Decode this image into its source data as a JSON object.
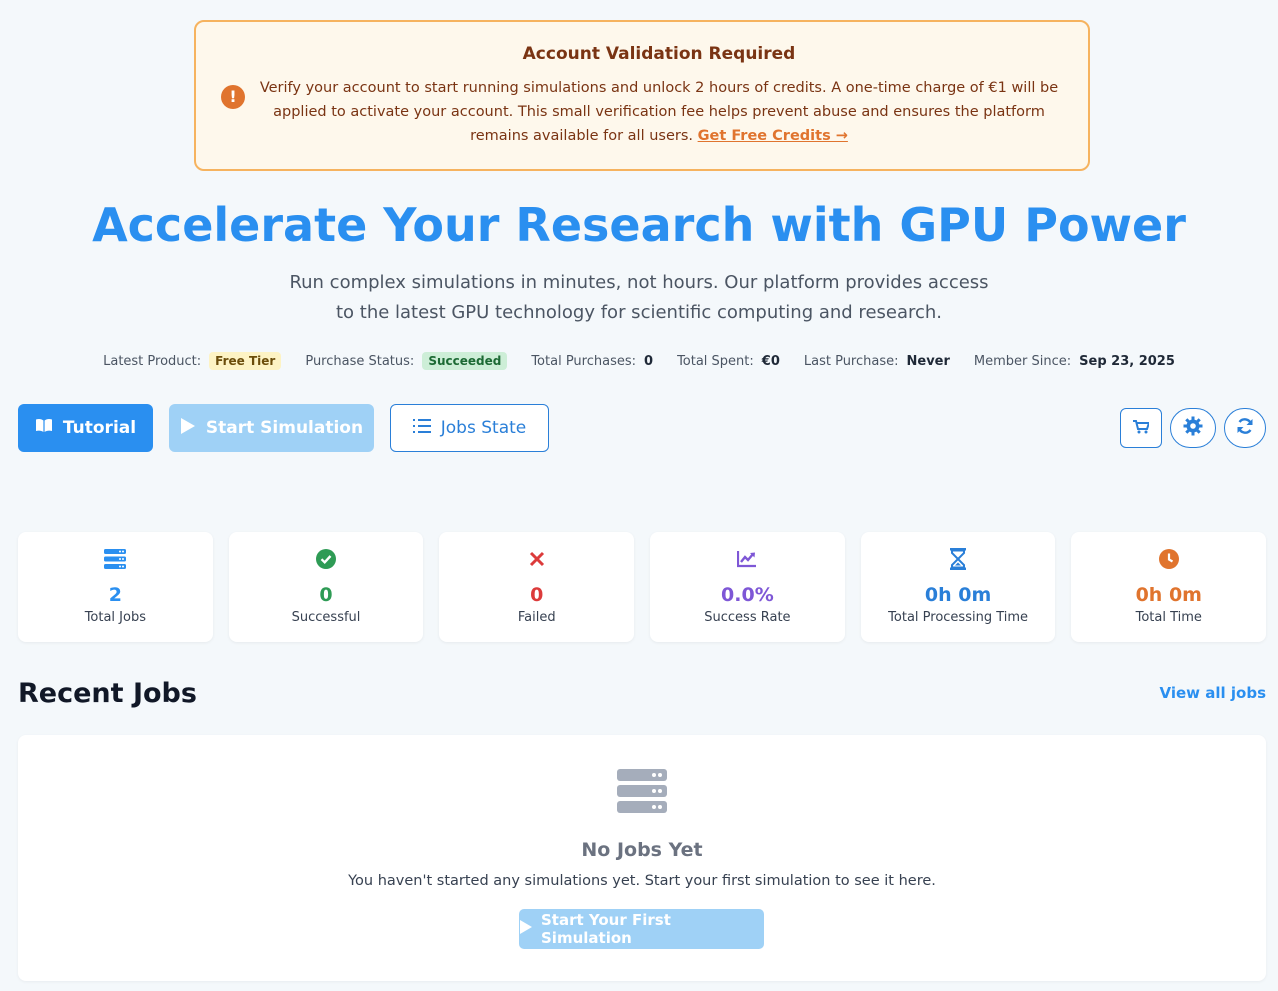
{
  "alert": {
    "title": "Account Validation Required",
    "body": "Verify your account to start running simulations and unlock 2 hours of credits. A one-time charge of €1 will be applied to activate your account. This small verification fee helps prevent abuse and ensures the platform remains available for all users.",
    "link": "Get Free Credits →",
    "icon": "exclamation-icon"
  },
  "hero": {
    "title": "Accelerate Your Research with GPU Power",
    "subtitle": "Run complex simulations in minutes, not hours. Our platform provides access to the latest GPU technology for scientific computing and research."
  },
  "meta": {
    "latest_product_label": "Latest Product:",
    "latest_product_value": "Free Tier",
    "purchase_status_label": "Purchase Status:",
    "purchase_status_value": "Succeeded",
    "total_purchases_label": "Total Purchases:",
    "total_purchases_value": "0",
    "total_spent_label": "Total Spent:",
    "total_spent_value": "€0",
    "last_purchase_label": "Last Purchase:",
    "last_purchase_value": "Never",
    "member_since_label": "Member Since:",
    "member_since_value": "Sep 23, 2025"
  },
  "actions": {
    "tutorial": "Tutorial",
    "start_simulation": "Start Simulation",
    "jobs_state": "Jobs State"
  },
  "stats": [
    {
      "value": "2",
      "label": "Total Jobs",
      "color": "#2a8ff0",
      "icon": "server-icon"
    },
    {
      "value": "0",
      "label": "Successful",
      "color": "#2e9b55",
      "icon": "check-circle-icon"
    },
    {
      "value": "0",
      "label": "Failed",
      "color": "#dc3b3b",
      "icon": "x-icon"
    },
    {
      "value": "0.0%",
      "label": "Success Rate",
      "color": "#7e57d6",
      "icon": "chart-line-icon"
    },
    {
      "value": "0h 0m",
      "label": "Total Processing Time",
      "color": "#2a7fd8",
      "icon": "hourglass-icon"
    },
    {
      "value": "0h 0m",
      "label": "Total Time",
      "color": "#e0742e",
      "icon": "clock-icon"
    }
  ],
  "recent": {
    "title": "Recent Jobs",
    "view_all": "View all jobs",
    "empty_title": "No Jobs Yet",
    "empty_text": "You haven't started any simulations yet. Start your first simulation to see it here.",
    "empty_button": "Start Your First Simulation"
  },
  "colors": {
    "accent": "#2a8ff0",
    "alert_border": "#f6b35f",
    "alert_bg": "#fef8ec",
    "disabled_button": "#9fd1f6"
  }
}
